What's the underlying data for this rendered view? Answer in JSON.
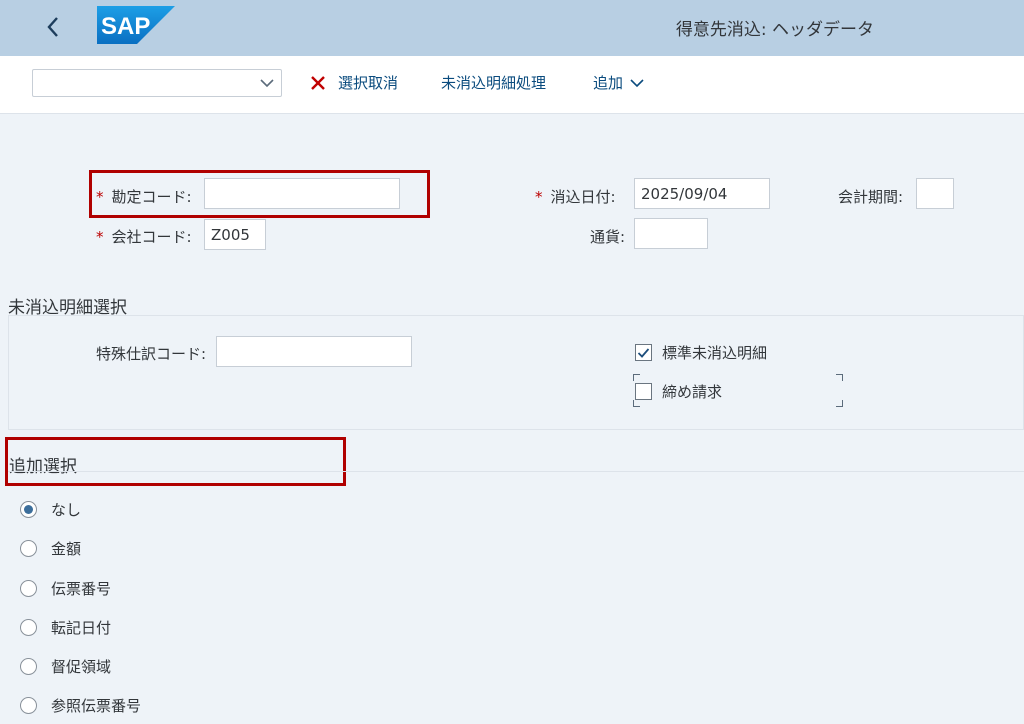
{
  "shell": {
    "title": "得意先消込: ヘッダデータ",
    "logo_text": "SAP"
  },
  "toolbar": {
    "variant_value": "",
    "cancel_label": "選択取消",
    "open_items_label": "未消込明細処理",
    "more_label": "追加"
  },
  "header": {
    "account_label": "勘定コード:",
    "account_value": "",
    "company_label": "会社コード:",
    "company_value": "Z005",
    "clearing_date_label": "消込日付:",
    "clearing_date_value": "2025/09/04",
    "period_label": "会計期間:",
    "period_value": "",
    "currency_label": "通貨:",
    "currency_value": ""
  },
  "open_item_selection": {
    "title": "未消込明細選択",
    "special_gl_label": "特殊仕訳コード:",
    "special_gl_value": "",
    "standard_items_label": "標準未消込明細",
    "standard_items_checked": true,
    "closing_billing_label": "締め請求",
    "closing_billing_checked": false
  },
  "additional_selection": {
    "title": "追加選択",
    "options": [
      "なし",
      "金額",
      "伝票番号",
      "転記日付",
      "督促領域",
      "参照伝票番号"
    ],
    "selected_index": 0
  },
  "colors": {
    "shell_bg": "#b8cfe3",
    "accent": "#0a4b7e",
    "required": "#bb0000",
    "highlight": "#b00000"
  }
}
